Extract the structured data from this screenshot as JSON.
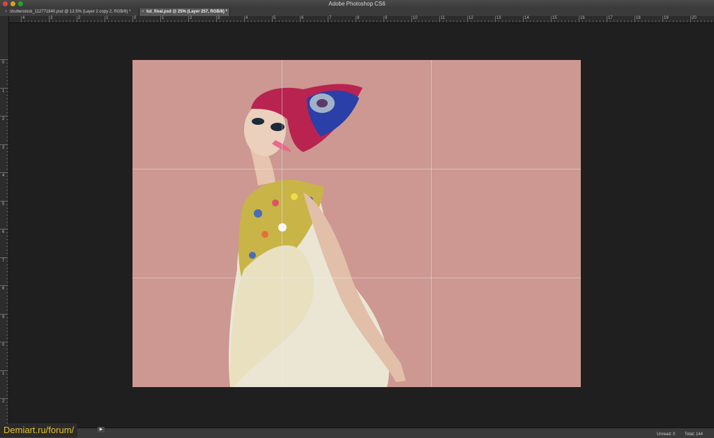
{
  "window": {
    "app_title": "Adobe Photoshop CS6"
  },
  "tabs": [
    {
      "label": "shutterstock_112771840.psd @ 12.5% (Layer 2 copy 2, RGB/8) *",
      "close": "×",
      "active": false
    },
    {
      "label": "tut_final.psd @ 25% (Layer 257, RGB/8) *",
      "close": "×",
      "active": true
    }
  ],
  "ruler_h_labels": [
    "4",
    "3",
    "2",
    "1",
    "0",
    "1",
    "2",
    "3",
    "4",
    "5",
    "6",
    "7",
    "8",
    "9",
    "10",
    "11",
    "12",
    "13",
    "14",
    "15",
    "16",
    "17",
    "18",
    "19",
    "20"
  ],
  "ruler_v_labels": [
    "0",
    "1",
    "2",
    "3",
    "4",
    "5",
    "6",
    "7",
    "8",
    "9",
    "0",
    "1",
    "2"
  ],
  "canvas": {
    "background_color": "#cc9891",
    "image_description_icon": "fashion-model-photo"
  },
  "status": {
    "nav_arrow": "▶",
    "unread": "Unread: 0",
    "total": "Total: 144"
  },
  "watermark": "Demiart.ru/forum/"
}
